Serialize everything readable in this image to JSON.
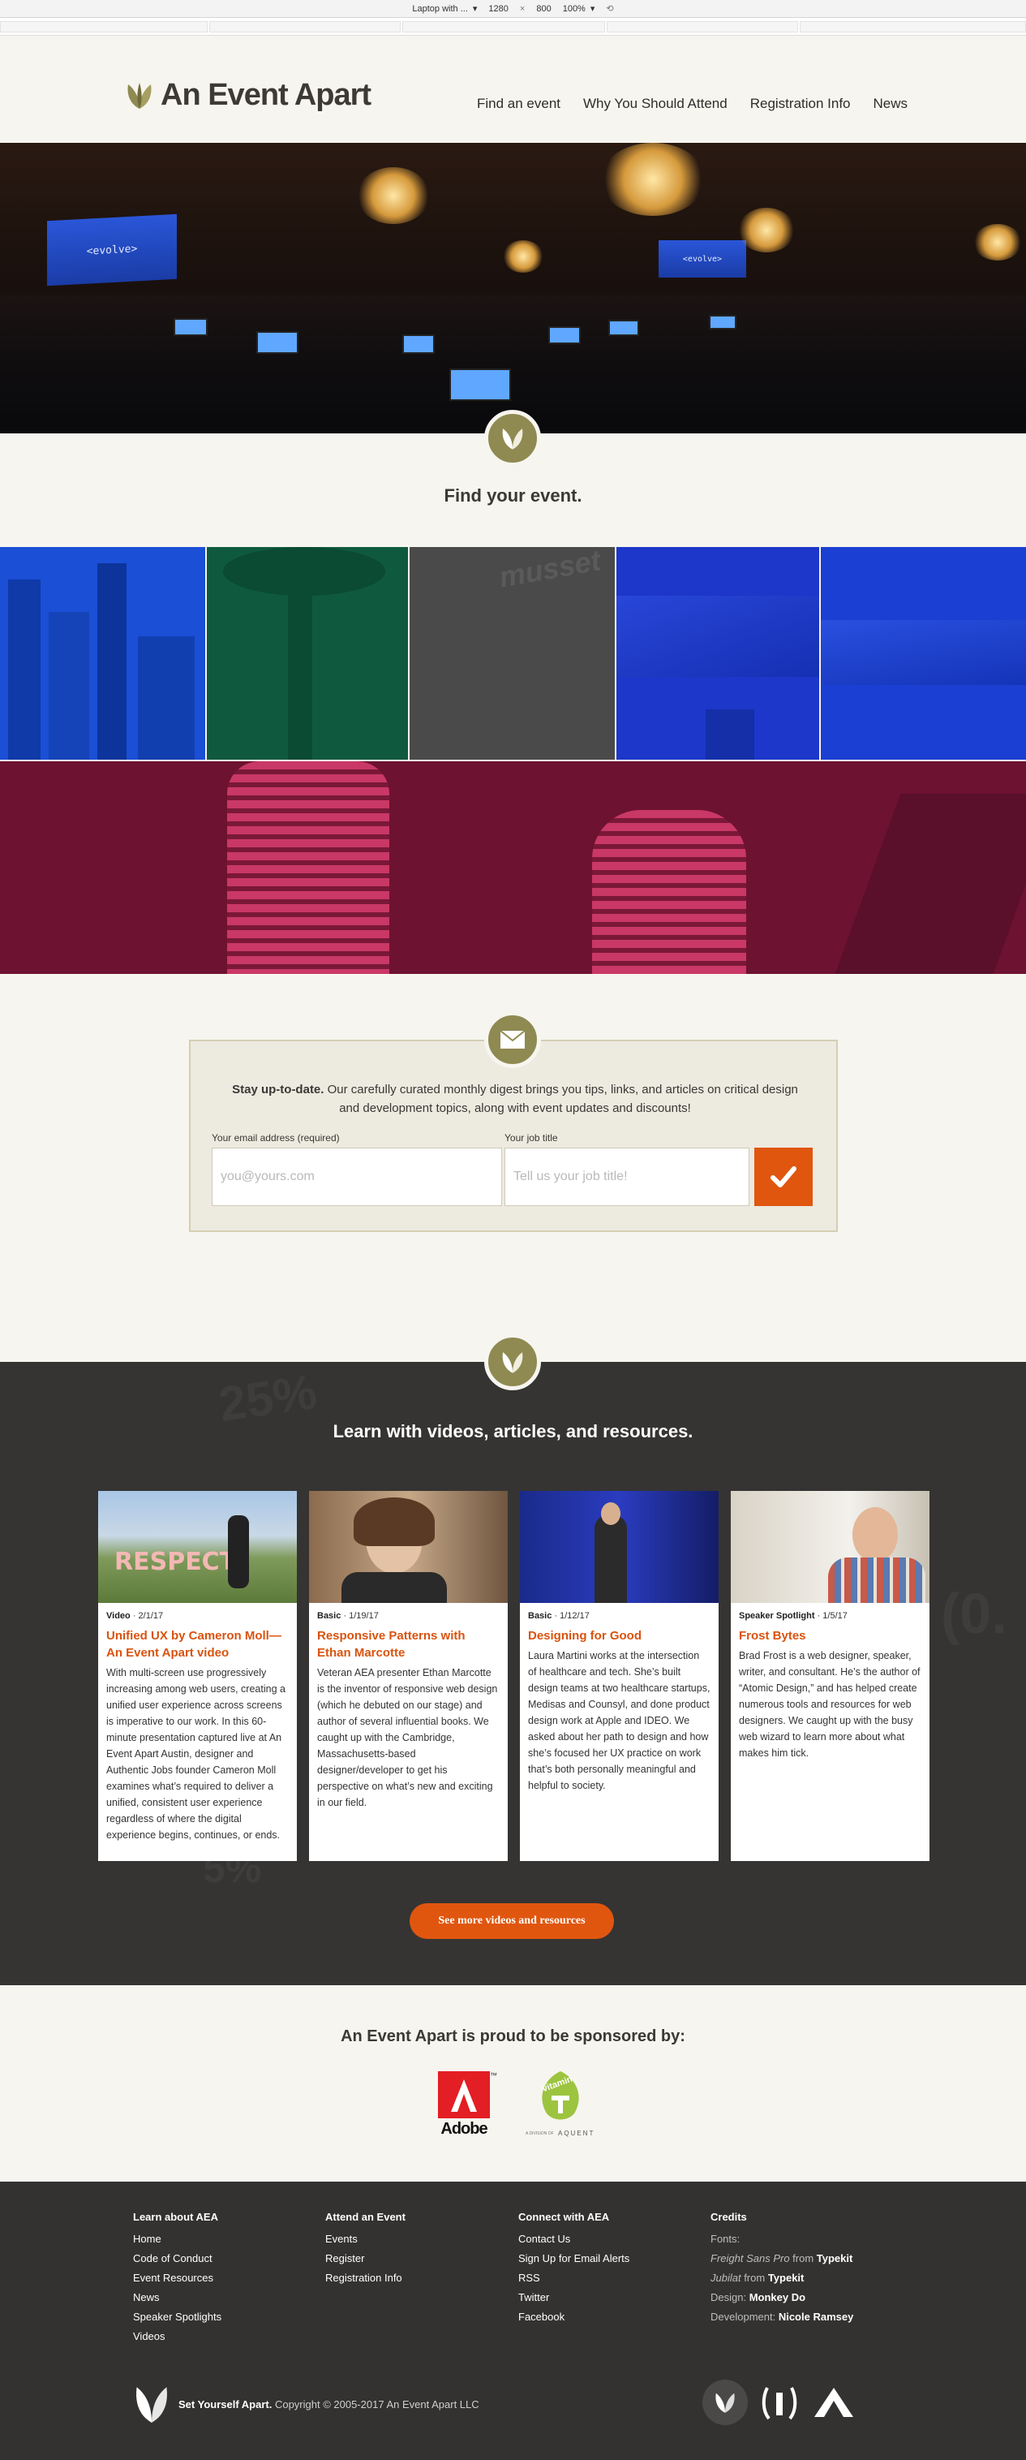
{
  "devtools": {
    "device": "Laptop with ...",
    "width": "1280",
    "times": "×",
    "height": "800",
    "zoom": "100%"
  },
  "header": {
    "logo_text": "An Event Apart",
    "nav": [
      "Find an event",
      "Why You Should Attend",
      "Registration Info",
      "News"
    ]
  },
  "hero": {
    "screen_text_left": "<evolve>",
    "screen_text_right": "<evolve>"
  },
  "events": {
    "title": "Find your event.",
    "tiles": [
      {
        "name": "seattle",
        "color": "#1a4fd6"
      },
      {
        "name": "space-needle",
        "color": "#0f5a3f"
      },
      {
        "name": "grey",
        "color": "#4a4a4a"
      },
      {
        "name": "denver",
        "color": "#1c37c9"
      },
      {
        "name": "mountains",
        "color": "#1b3fd2"
      },
      {
        "name": "chicago",
        "color": "#6e1232"
      }
    ],
    "watermark": "musset"
  },
  "newsletter": {
    "lead_bold": "Stay up-to-date.",
    "lead_text": " Our carefully curated monthly digest brings you tips, links, and articles on critical design and development topics, along with event updates and discounts!",
    "email_label": "Your email address (required)",
    "email_placeholder": "you@yours.com",
    "job_label": "Your job title",
    "job_placeholder": "Tell us your job title!"
  },
  "resources": {
    "title": "Learn with videos, articles, and resources.",
    "cards": [
      {
        "category": "Video",
        "date": " · 2/1/17",
        "title": "Unified UX by Cameron Moll—An Event Apart video",
        "desc": "With multi-screen use progressively increasing among web users, creating a unified user experience across screens is imperative to our work. In this 60-minute presentation captured live at An Event Apart Austin, designer and Authentic Jobs founder Cameron Moll examines what’s required to deliver a unified, consistent user experience regardless of where the digital experience begins, continues, or ends.",
        "image_text": "RESPECT"
      },
      {
        "category": "Basic",
        "date": " · 1/19/17",
        "title": "Responsive Patterns with Ethan Marcotte",
        "desc": "Veteran AEA presenter Ethan Marcotte is the inventor of responsive web design (which he debuted on our stage) and author of several influential books. We caught up with the Cambridge, Massachusetts-based designer/developer to get his perspective on what’s new and exciting in our field."
      },
      {
        "category": "Basic",
        "date": " · 1/12/17",
        "title": "Designing for Good",
        "desc": "Laura Martini works at the intersection of healthcare and tech. She’s built design teams at two healthcare startups, Medisas and Counsyl, and done product design work at Apple and IDEO. We asked about her path to design and how she’s focused her UX practice on work that’s both personally meaningful and helpful to society."
      },
      {
        "category": "Speaker Spotlight",
        "date": " · 1/5/17",
        "title": "Frost Bytes",
        "desc": "Brad Frost is a web designer, speaker, writer, and consultant. He’s the author of “Atomic Design,” and has helped create numerous tools and resources for web designers. We caught up with the busy web wizard to learn more about what makes him tick."
      }
    ],
    "more_button": "See more videos and resources",
    "bg_numbers": [
      "25%",
      "5%",
      "(0."
    ]
  },
  "sponsors": {
    "title": "An Event Apart is proud to be sponsored by:",
    "adobe": "Adobe",
    "adobe_tm": "™",
    "vitamin": "vitamin",
    "vitamin_sub": "A DIVISION OF",
    "aquent": "AQUENT"
  },
  "footer": {
    "cols": [
      {
        "heading": "Learn about AEA",
        "links": [
          "Home",
          "Code of Conduct",
          "Event Resources",
          "News",
          "Speaker Spotlights",
          "Videos"
        ]
      },
      {
        "heading": "Attend an Event",
        "links": [
          "Events",
          "Register",
          "Registration Info"
        ]
      },
      {
        "heading": "Connect with AEA",
        "links": [
          "Contact Us",
          "Sign Up for Email Alerts",
          "RSS",
          "Twitter",
          "Facebook"
        ]
      }
    ],
    "credits": {
      "heading": "Credits",
      "fonts_label": "Fonts:",
      "font1": "Freight Sans Pro",
      "from": " from ",
      "font1_src": "Typekit",
      "font2": "Jubilat",
      "font2_src": "Typekit",
      "design_label": "Design: ",
      "design": "Monkey Do",
      "dev_label": "Development: ",
      "dev": "Nicole Ramsey"
    },
    "tagline": "Set Yourself Apart.",
    "copyright": " Copyright © 2005-2017 An Event Apart LLC"
  },
  "colors": {
    "accent": "#e0560f",
    "olive": "#8f8a52",
    "footer_bg": "#333231"
  }
}
